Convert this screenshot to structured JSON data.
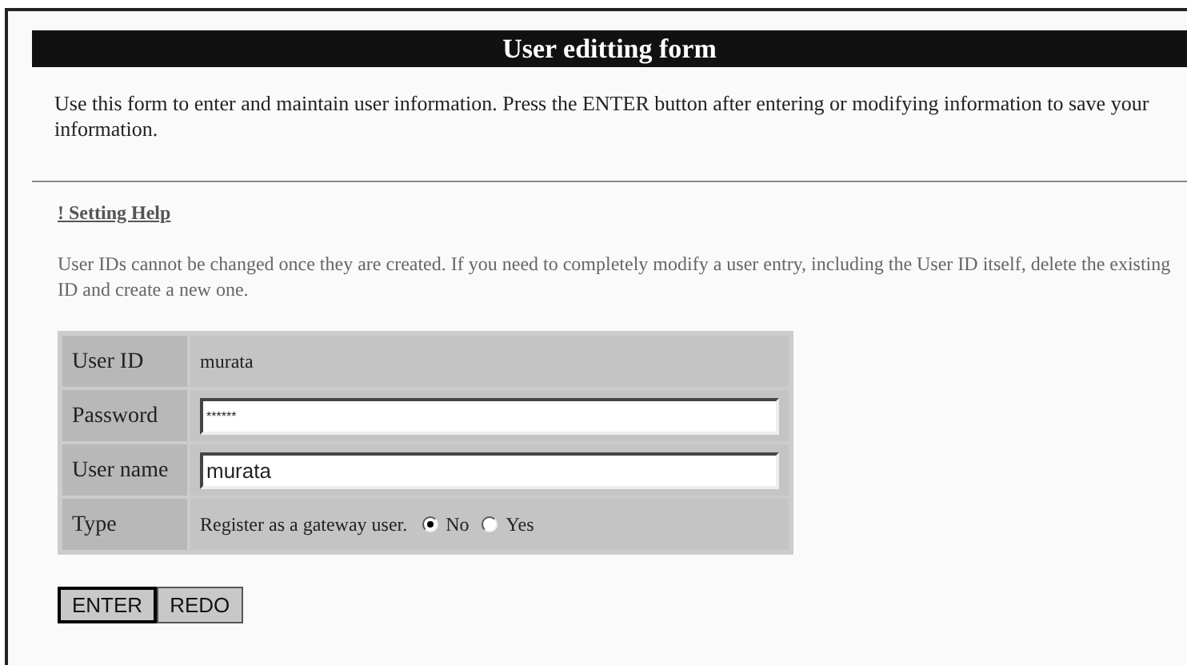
{
  "title": "User editting form",
  "intro": "Use this form to enter and maintain user information. Press the ENTER button after entering or modifying information to save your information.",
  "help_link": "! Setting Help",
  "help_text": "User IDs cannot be changed once they are created. If you need to completely modify a user entry, including the User ID itself, delete the existing ID and create a new one.",
  "rows": [
    {
      "kind": "text",
      "label": "User ID",
      "value": "murata"
    },
    {
      "kind": "input",
      "label": "Password",
      "value": "******"
    },
    {
      "kind": "input",
      "label": "User name",
      "value": "murata"
    },
    {
      "kind": "radio",
      "label": "Type",
      "prompt": "Register as a gateway user.",
      "options": [
        {
          "label": "No",
          "selected": true
        },
        {
          "label": "Yes",
          "selected": false
        }
      ]
    }
  ],
  "buttons": [
    "ENTER",
    "REDO"
  ]
}
